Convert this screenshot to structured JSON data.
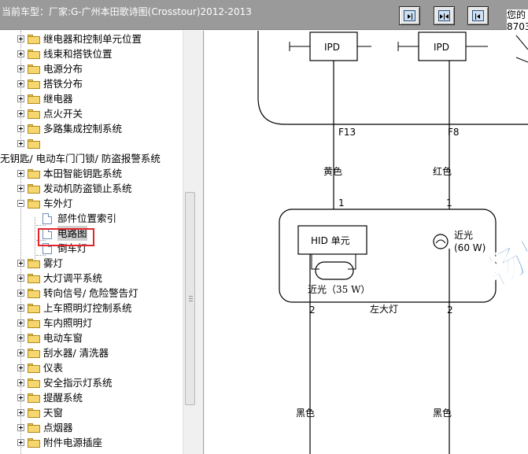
{
  "header": {
    "title": "当前车型：厂家:G-广州本田歌诗图(Crosstour)2012-2013",
    "right_text_1": "您的",
    "right_text_2": "8703"
  },
  "toolbar": {
    "buttons": [
      {
        "name": "collapse-left-button",
        "icon": "panel-left-icon"
      },
      {
        "name": "split-view-button",
        "icon": "panel-split-icon"
      },
      {
        "name": "collapse-right-button",
        "icon": "panel-right-icon"
      }
    ]
  },
  "tree": {
    "items": [
      {
        "label": "继电器和控制单元位置",
        "level": 1,
        "type": "folder",
        "expanded": false
      },
      {
        "label": "线束和搭铁位置",
        "level": 1,
        "type": "folder",
        "expanded": false
      },
      {
        "label": "电源分布",
        "level": 1,
        "type": "folder",
        "expanded": false
      },
      {
        "label": "搭铁分布",
        "level": 1,
        "type": "folder",
        "expanded": false
      },
      {
        "label": "继电器",
        "level": 1,
        "type": "folder",
        "expanded": false
      },
      {
        "label": "点火开关",
        "level": 1,
        "type": "folder",
        "expanded": false
      },
      {
        "label": "多路集成控制系统",
        "level": 1,
        "type": "folder",
        "expanded": false
      },
      {
        "label": "",
        "level": 1,
        "type": "folder",
        "expanded": false
      },
      {
        "label": "无钥匙/ 电动车门门锁/ 防盗报警系统",
        "level": 0,
        "type": "text"
      },
      {
        "label": "本田智能钥匙系统",
        "level": 1,
        "type": "folder",
        "expanded": false
      },
      {
        "label": "发动机防盗锁止系统",
        "level": 1,
        "type": "folder",
        "expanded": false
      },
      {
        "label": "车外灯",
        "level": 1,
        "type": "folder",
        "expanded": true
      },
      {
        "label": "部件位置索引",
        "level": 2,
        "type": "doc"
      },
      {
        "label": "电路图",
        "level": 2,
        "type": "doc",
        "selected": true
      },
      {
        "label": "倒车灯",
        "level": 2,
        "type": "doc"
      },
      {
        "label": "雾灯",
        "level": 1,
        "type": "folder",
        "expanded": false
      },
      {
        "label": "大灯调平系统",
        "level": 1,
        "type": "folder",
        "expanded": false
      },
      {
        "label": "转向信号/ 危险警告灯",
        "level": 1,
        "type": "folder",
        "expanded": false
      },
      {
        "label": "上车照明灯控制系统",
        "level": 1,
        "type": "folder",
        "expanded": false
      },
      {
        "label": "车内照明灯",
        "level": 1,
        "type": "folder",
        "expanded": false
      },
      {
        "label": "电动车窗",
        "level": 1,
        "type": "folder",
        "expanded": false
      },
      {
        "label": "刮水器/ 清洗器",
        "level": 1,
        "type": "folder",
        "expanded": false
      },
      {
        "label": "仪表",
        "level": 1,
        "type": "folder",
        "expanded": false
      },
      {
        "label": "安全指示灯系统",
        "level": 1,
        "type": "folder",
        "expanded": false
      },
      {
        "label": "提醒系统",
        "level": 1,
        "type": "folder",
        "expanded": false
      },
      {
        "label": "天窗",
        "level": 1,
        "type": "folder",
        "expanded": false
      },
      {
        "label": "点烟器",
        "level": 1,
        "type": "folder",
        "expanded": false
      },
      {
        "label": "附件电源插座",
        "level": 1,
        "type": "folder",
        "expanded": false
      }
    ]
  },
  "diagram": {
    "ipd_left": "IPD",
    "ipd_right": "IPD",
    "fuse_left": "F13",
    "fuse_right": "F8",
    "wire_left_top": "黄色",
    "wire_right_top": "红色",
    "pin_left_top": "1",
    "pin_right_top": "1",
    "hid_unit": "HID 单元",
    "low_beam_label": "近光",
    "low_beam_watts": "(60 W)",
    "hid_bulb": "近光（35 W）",
    "headlight_name": "左大灯",
    "pin_left_bottom": "2",
    "pin_right_bottom": "2",
    "wire_left_bottom": "黑色",
    "wire_right_bottom": "黑色",
    "watermark": "畅易"
  },
  "colors": {
    "topbar": "#9a9a9a",
    "selection_box": "#e4262b",
    "watermark": "#1a5fb4"
  }
}
